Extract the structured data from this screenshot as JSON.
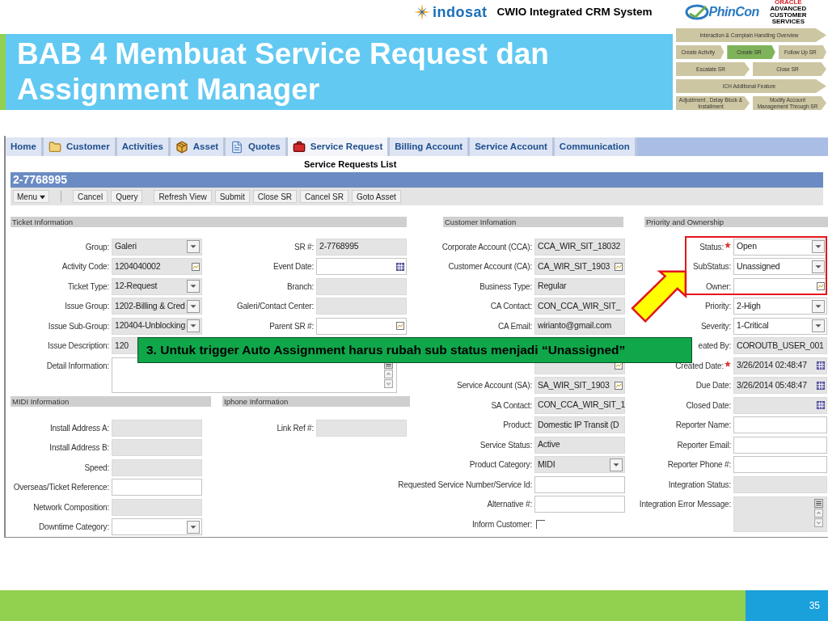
{
  "slide": {
    "brand": "indosat",
    "system_title": "CWIO Integrated CRM System",
    "partner_logo": "PhinCon",
    "vendor_logo": "ORACLE",
    "vendor_tagline": "ADVANCED CUSTOMER SERVICES",
    "title_lines": [
      "BAB 4 Membuat Service Request dan",
      "Assignment Manager"
    ],
    "nav_map": [
      {
        "items": [
          {
            "label": "Interaction & Complain Handling Overview",
            "selected": false
          }
        ]
      },
      {
        "items": [
          {
            "label": "Create Activity",
            "selected": false
          },
          {
            "label": "Create SR",
            "selected": true
          },
          {
            "label": "Follow Up SR",
            "selected": false
          }
        ]
      },
      {
        "items": [
          {
            "label": "Escalate SR",
            "selected": false
          },
          {
            "label": "Close SR",
            "selected": false
          }
        ]
      },
      {
        "items": [
          {
            "label": "ICH Additional Feature",
            "selected": false
          }
        ]
      },
      {
        "items": [
          {
            "label": "Adjustment , Delay Block & Installment",
            "selected": false
          },
          {
            "label": "Modify Account Management Through SR",
            "selected": false
          }
        ]
      }
    ],
    "page_number": "35"
  },
  "app": {
    "tabs": [
      {
        "label": "Home",
        "selected": false
      },
      {
        "label": "Customer",
        "selected": false
      },
      {
        "label": "Activities",
        "selected": false
      },
      {
        "label": "Asset",
        "selected": false
      },
      {
        "label": "Quotes",
        "selected": false
      },
      {
        "label": "Service Request",
        "selected": true
      },
      {
        "label": "Billing Account",
        "selected": false
      },
      {
        "label": "Service Account",
        "selected": false
      },
      {
        "label": "Communication",
        "selected": false
      }
    ],
    "view_title": "Service Requests List",
    "record_title": "2-7768995",
    "menu_button": "Menu",
    "toolbar": [
      "Cancel",
      "Query",
      "Refresh View",
      "Submit",
      "Close SR",
      "Cancel SR",
      "Goto Asset"
    ],
    "ticket": {
      "title": "Ticket Information",
      "left": [
        {
          "label": "Group:",
          "value": "Galeri",
          "kind": "select",
          "readonly": true
        },
        {
          "label": "Activity Code:",
          "value": "1204040002",
          "kind": "pick",
          "readonly": true
        },
        {
          "label": "Ticket Type:",
          "value": "12-Request",
          "kind": "select",
          "readonly": true
        },
        {
          "label": "Issue Group:",
          "value": "1202-Billing & Cred",
          "kind": "select",
          "readonly": true
        },
        {
          "label": "Issue Sub-Group:",
          "value": "120404-Unblocking",
          "kind": "select",
          "readonly": true
        },
        {
          "label": "Issue Description:",
          "value": "120",
          "kind": "text",
          "readonly": true
        }
      ],
      "right": [
        {
          "label": "SR #:",
          "value": "2-7768995",
          "kind": "text",
          "readonly": true
        },
        {
          "label": "Event Date:",
          "kind": "date",
          "readonly": false
        },
        {
          "label": "Branch:",
          "kind": "text",
          "readonly": true
        },
        {
          "label": "Galeri/Contact Center:",
          "kind": "text",
          "readonly": true
        },
        {
          "label": "Parent SR #:",
          "kind": "pick",
          "readonly": false
        }
      ],
      "detail": {
        "label": "Detail Information:",
        "kind": "textarea",
        "readonly": false
      }
    },
    "midi": {
      "title": "MIDI Information",
      "fields": [
        {
          "label": "Install Address A:",
          "kind": "text",
          "readonly": true
        },
        {
          "label": "Install Address B:",
          "kind": "text",
          "readonly": true
        },
        {
          "label": "Speed:",
          "kind": "text",
          "readonly": true
        },
        {
          "label": "Overseas/Ticket Reference:",
          "kind": "text",
          "readonly": false
        },
        {
          "label": "Network Composition:",
          "kind": "text",
          "readonly": true
        },
        {
          "label": "Downtime Category:",
          "kind": "select",
          "readonly": false
        }
      ]
    },
    "iphone": {
      "title": "Iphone Information",
      "fields": [
        {
          "label": "Link Ref #:",
          "kind": "text",
          "readonly": true
        }
      ]
    },
    "customer": {
      "title": "Customer Infomation",
      "fields": [
        {
          "label": "Corporate Account (CCA):",
          "value": "CCA_WIR_SIT_18032",
          "kind": "text",
          "readonly": true
        },
        {
          "label": "Customer Account (CA):",
          "value": "CA_WIR_SIT_1903",
          "kind": "pick",
          "readonly": true
        },
        {
          "label": "Business Type:",
          "value": "Regular",
          "kind": "text",
          "readonly": true
        },
        {
          "label": "CA Contact:",
          "value": "CON_CCA_WIR_SIT_",
          "kind": "text",
          "readonly": true
        },
        {
          "label": "CA Email:",
          "value": "wirianto@gmail.com",
          "kind": "text",
          "readonly": true
        },
        {
          "kind": "covered"
        },
        {
          "kind": "pick",
          "readonly": true
        },
        {
          "label": "Service Account (SA):",
          "value": "SA_WIR_SIT_1903",
          "kind": "pick",
          "readonly": true
        },
        {
          "label": "SA Contact:",
          "value": "CON_CCA_WIR_SIT_1",
          "kind": "text",
          "readonly": true
        },
        {
          "label": "Product:",
          "value": "Domestic IP Transit (D",
          "kind": "text",
          "readonly": true
        },
        {
          "label": "Service Status:",
          "value": "Active",
          "kind": "text",
          "readonly": true
        },
        {
          "label": "Product Category:",
          "value": "MIDI",
          "kind": "select",
          "readonly": true
        },
        {
          "label": "Requested Service Number/Service Id:",
          "kind": "text",
          "readonly": false
        },
        {
          "label": "Alternative #:",
          "kind": "text",
          "readonly": false
        },
        {
          "label": "Inform Customer:",
          "kind": "checkbox",
          "checked": false
        }
      ]
    },
    "priority": {
      "title": "Priority and Ownership",
      "fields": [
        {
          "label": "Status:",
          "value": "Open",
          "kind": "select",
          "readonly": false,
          "required": true
        },
        {
          "label": "SubStatus:",
          "value": "Unassigned",
          "kind": "select",
          "readonly": false,
          "required": false
        },
        {
          "label": "Owner:",
          "kind": "pick",
          "readonly": false,
          "required": false
        },
        {
          "label": "Priority:",
          "value": "2-High",
          "kind": "select",
          "readonly": false,
          "required": false
        },
        {
          "label": "Severity:",
          "value": "1-Critical",
          "kind": "select",
          "readonly": false,
          "required": false
        },
        {
          "label": "eated By:",
          "value": "COROUTB_USER_001",
          "kind": "text",
          "readonly": true,
          "required": false
        },
        {
          "label": "Created Date:",
          "value": "3/26/2014 02:48:47",
          "kind": "date",
          "readonly": true,
          "required": true
        },
        {
          "label": "Due Date:",
          "value": "3/26/2014 05:48:47",
          "kind": "date",
          "readonly": true,
          "required": false
        },
        {
          "label": "Closed Date:",
          "kind": "date",
          "readonly": true,
          "required": false
        },
        {
          "label": "Reporter Name:",
          "kind": "text",
          "readonly": false,
          "required": false
        },
        {
          "label": "Reporter Email:",
          "kind": "text",
          "readonly": false,
          "required": false
        },
        {
          "label": "Reporter Phone #:",
          "kind": "text",
          "readonly": false,
          "required": false
        },
        {
          "label": "Integration Status:",
          "kind": "text",
          "readonly": true,
          "required": false
        },
        {
          "label": "Integration Error Message:",
          "kind": "textarea",
          "readonly": true,
          "required": false
        }
      ]
    }
  },
  "callout": {
    "text": "3. Untuk trigger Auto Assignment harus rubah sub status menjadi “Unassigned”"
  }
}
